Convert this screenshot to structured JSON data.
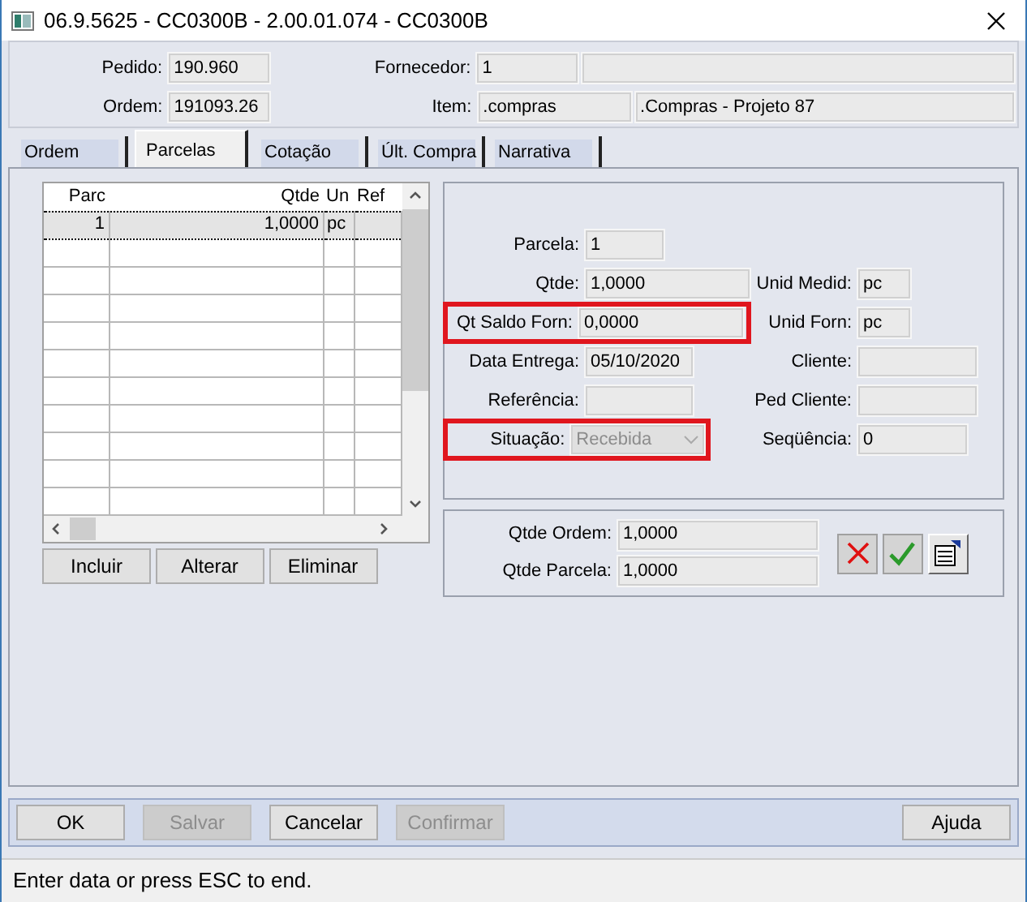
{
  "window": {
    "title": "06.9.5625 - CC0300B - 2.00.01.074 - CC0300B"
  },
  "header_rows": [
    {
      "label": "Pedido:",
      "value": "190.960",
      "label2": "Fornecedor:",
      "fields2": [
        {
          "kind": "text",
          "value": "1"
        },
        {
          "kind": "blank"
        }
      ]
    },
    {
      "label": "Ordem:",
      "value": "191093.26",
      "label2": "Item:",
      "fields2": [
        {
          "kind": "text",
          "value": ".compras"
        },
        {
          "kind": "text",
          "value": ".Compras - Projeto 87"
        }
      ]
    }
  ],
  "tabs": [
    {
      "label": "Ordem",
      "selected": false
    },
    {
      "label": "Parcelas",
      "selected": true
    },
    {
      "label": "Cotação",
      "selected": false
    },
    {
      "label": "Últ. Compra",
      "selected": false
    },
    {
      "label": "Narrativa",
      "selected": false
    }
  ],
  "grid": {
    "columns": [
      "Parc",
      "Qtde",
      "Un",
      "Ref"
    ],
    "rows": [
      {
        "parc": "1",
        "qtde": "1,0000",
        "un": "pc",
        "selected": true
      }
    ]
  },
  "grid_buttons": [
    "Incluir",
    "Alterar",
    "Eliminar"
  ],
  "form_rows": [
    {
      "left": {
        "label": "Parcela:",
        "value": "1",
        "kind": "text",
        "highlighted": false
      }
    },
    {
      "left": {
        "label": "Qtde:",
        "value": "1,0000",
        "kind": "text",
        "highlighted": false
      },
      "right": {
        "label": "Unid Medid:",
        "value": "pc"
      }
    },
    {
      "left": {
        "label": "Qt Saldo Forn:",
        "value": "0,0000",
        "kind": "text",
        "highlighted": true
      },
      "right": {
        "label": "Unid Forn:",
        "value": "pc"
      }
    },
    {
      "left": {
        "label": "Data Entrega:",
        "value": "05/10/2020",
        "kind": "text",
        "highlighted": false
      },
      "right": {
        "label": "Cliente:"
      }
    },
    {
      "left": {
        "label": "Referência:",
        "kind": "text",
        "highlighted": false
      },
      "right": {
        "label": "Ped Cliente:"
      }
    },
    {
      "left": {
        "label": "Situação:",
        "value": "Recebida",
        "kind": "select",
        "disabled": true,
        "highlighted": true
      },
      "right": {
        "label": "Seqüência:",
        "value": "0"
      }
    }
  ],
  "totals": [
    {
      "label": "Qtde Ordem:",
      "value": "1,0000"
    },
    {
      "label": "Qtde Parcela:",
      "value": "1,0000"
    }
  ],
  "action_icons": [
    {
      "kind": "cancel"
    },
    {
      "kind": "confirm"
    },
    {
      "kind": "properties"
    }
  ],
  "footer_buttons": [
    {
      "label": "OK",
      "disabled": false
    },
    {
      "label": "Salvar",
      "disabled": true
    },
    {
      "label": "Cancelar",
      "disabled": false
    },
    {
      "label": "Confirmar",
      "disabled": true
    }
  ],
  "help_button": {
    "label": "Ajuda",
    "disabled": false
  },
  "status_bar": "Enter data or press ESC to end."
}
